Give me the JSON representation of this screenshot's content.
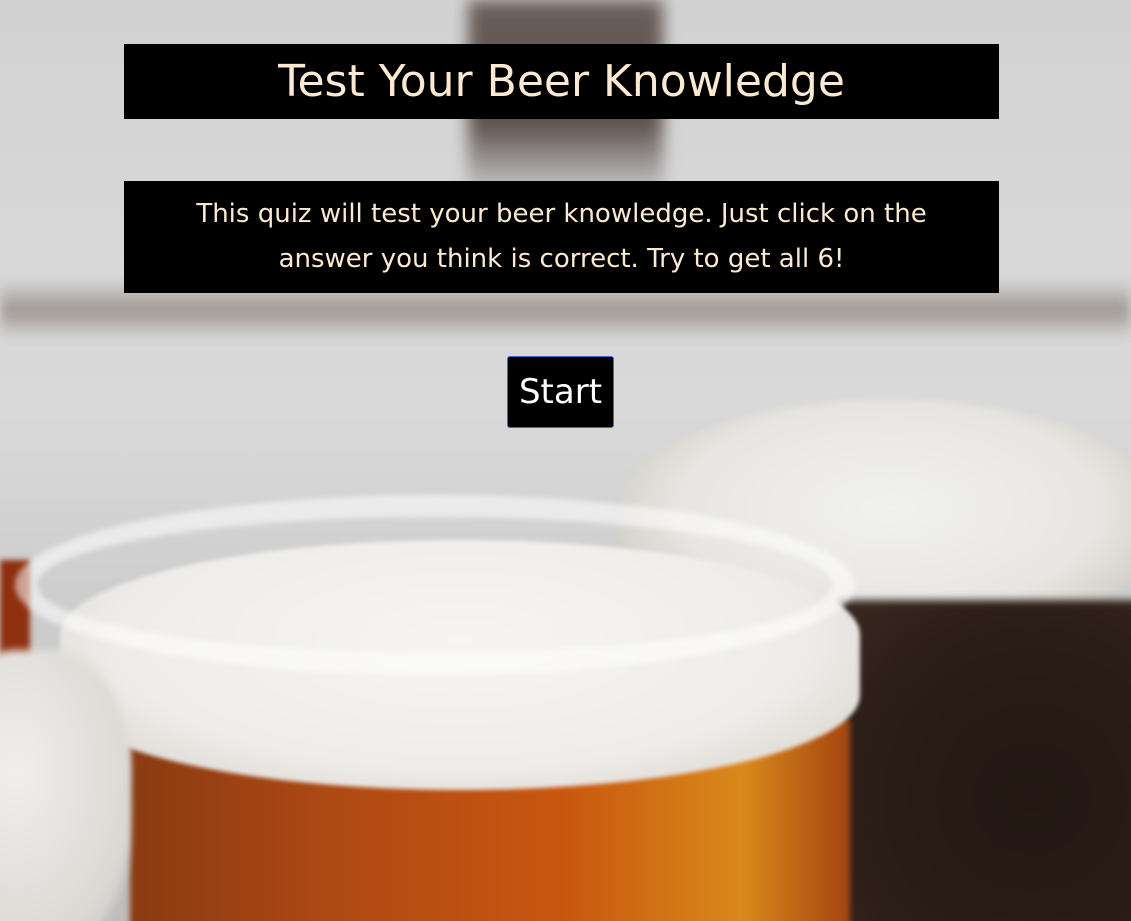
{
  "header": {
    "title": "Test Your Beer Knowledge"
  },
  "intro": {
    "description": "This quiz will test your beer knowledge. Just click on the answer you think is correct. Try to get all 6!"
  },
  "actions": {
    "start_label": "Start"
  },
  "colors": {
    "panel_background": "#000000",
    "text_cream": "#fbe9d2",
    "button_text": "#ffffff",
    "button_border": "#3b6bd6"
  }
}
